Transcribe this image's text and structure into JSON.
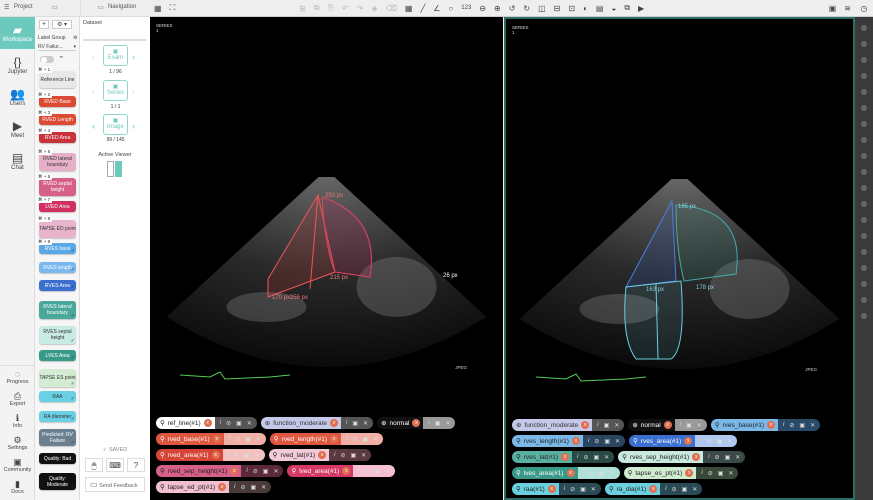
{
  "header": {
    "project": "Project",
    "navigation": "Navigation"
  },
  "sidebar": {
    "main": [
      {
        "label": "Workspace",
        "icon": "image-icon"
      },
      {
        "label": "Jupyter",
        "icon": "braces-icon"
      },
      {
        "label": "Users",
        "icon": "users-icon"
      },
      {
        "label": "Meet",
        "icon": "video-icon"
      },
      {
        "label": "Chat",
        "icon": "chat-icon"
      }
    ],
    "bottom": [
      {
        "label": "Progress",
        "icon": "progress-icon"
      },
      {
        "label": "Export",
        "icon": "export-icon"
      },
      {
        "label": "Info",
        "icon": "info-icon"
      },
      {
        "label": "Settings",
        "icon": "gear-icon"
      },
      {
        "label": "Community",
        "icon": "community-icon"
      },
      {
        "label": "Docs",
        "icon": "docs-icon"
      }
    ]
  },
  "labels": {
    "group_label": "Label Group",
    "group_value": "RV Failur...",
    "items": [
      {
        "label": "Reference Line",
        "key": "⌘ + 1",
        "color": "#e8e8e8",
        "text": "#333"
      },
      {
        "label": "RVED Base",
        "key": "⌘ + 2",
        "color": "#dc4a33",
        "text": "#fff"
      },
      {
        "label": "RVED Length",
        "key": "⌘ + 3",
        "color": "#dc4a33",
        "text": "#fff"
      },
      {
        "label": "RVED Area",
        "key": "⌘ + 4",
        "color": "#c8323a",
        "text": "#fff"
      },
      {
        "label": "RVED lateral boundary",
        "key": "⌘ + 5",
        "color": "#e6b0c8",
        "text": "#333"
      },
      {
        "label": "RVED septal height",
        "key": "⌘ + 6",
        "color": "#d6608a",
        "text": "#fff"
      },
      {
        "label": "LVED Area",
        "key": "⌘ + 7",
        "color": "#d03060",
        "text": "#fff"
      },
      {
        "label": "TAPSE ED point",
        "key": "⌘ + 8",
        "color": "#e8b4cc",
        "text": "#333"
      },
      {
        "label": "RVES base",
        "key": "⌘ + 9",
        "color": "#5aa8e6",
        "text": "#fff"
      },
      {
        "label": "RVES length",
        "key": "",
        "color": "#7ab8ee",
        "text": "#fff"
      },
      {
        "label": "RVES Area",
        "key": "",
        "color": "#3a6fd0",
        "text": "#fff"
      },
      {
        "label": "RVES lateral boundary",
        "key": "",
        "color": "#4aa89a",
        "text": "#fff"
      },
      {
        "label": "RVES septal height",
        "key": "",
        "color": "#c8ece4",
        "text": "#333"
      },
      {
        "label": "LVES Area",
        "key": "",
        "color": "#3a9a8a",
        "text": "#fff"
      },
      {
        "label": "TAPSE ES point",
        "key": "",
        "color": "#d4ecd4",
        "text": "#333"
      },
      {
        "label": "RAA",
        "key": "",
        "color": "#6ad0e4",
        "text": "#333"
      },
      {
        "label": "RA diameter",
        "key": "",
        "color": "#6ad0e4",
        "text": "#333"
      },
      {
        "label": "Predicted: RV Failure",
        "key": "",
        "color": "#6a8090",
        "text": "#fff"
      },
      {
        "label": "Quality: Bad",
        "key": "",
        "color": "#111",
        "text": "#fff"
      },
      {
        "label": "Quality: Moderate",
        "key": "",
        "color": "#111",
        "text": "#fff"
      }
    ]
  },
  "navigation": {
    "dataset": "Dataset",
    "exam": "Exam",
    "exam_count": "1 / 96",
    "series": "Series",
    "series_count": "1 / 1",
    "image": "Image",
    "image_count": "99 / 145",
    "active_viewer": "Active Viewer",
    "saved": "SAVED",
    "send_feedback": "Send Feedback"
  },
  "toolbar": {
    "numbers": "123"
  },
  "viewers": [
    {
      "series_label": "SERIES",
      "series_num": "1",
      "format": "JPEG",
      "measurements": [
        "250 px",
        "215 px",
        "256 px",
        "170 px",
        "26 px"
      ],
      "pills": [
        [
          {
            "name": "ref_line(#1)",
            "icon": "pin",
            "bg": "#ffffff",
            "fg": "#222",
            "rbg": "#555"
          },
          {
            "name": "function_moderate",
            "icon": "globe",
            "bg": "#c5c8e8",
            "fg": "#333",
            "rbg": "#555"
          },
          {
            "name": "normal",
            "icon": "globe",
            "bg": "#111",
            "fg": "#fff",
            "rbg": "#999"
          }
        ],
        [
          {
            "name": "rved_base(#1)",
            "icon": "pin",
            "bg": "#e0573f",
            "fg": "#fff",
            "rbg": "#f0b0a5"
          },
          {
            "name": "rved_length(#1)",
            "icon": "pin",
            "bg": "#e0573f",
            "fg": "#fff",
            "rbg": "#f0b0a5"
          }
        ],
        [
          {
            "name": "rved_area(#1)",
            "icon": "pin",
            "bg": "#d64535",
            "fg": "#fff",
            "rbg": "#f3c0c0"
          },
          {
            "name": "rved_lat(#1)",
            "icon": "pin",
            "bg": "#f2cad8",
            "fg": "#222",
            "rbg": "#5a3a40"
          }
        ],
        [
          {
            "name": "rved_sep_height(#1)",
            "icon": "pin",
            "bg": "#d6608a",
            "fg": "#222",
            "rbg": "#5a2a3a"
          },
          {
            "name": "lved_area(#1)",
            "icon": "pin",
            "bg": "#d63865",
            "fg": "#fff",
            "rbg": "#f5c0d0"
          }
        ],
        [
          {
            "name": "tapse_ed_pt(#1)",
            "icon": "pin",
            "bg": "#f0c0d0",
            "fg": "#222",
            "rbg": "#4a3a3a"
          }
        ]
      ]
    },
    {
      "series_label": "SERIES",
      "series_num": "1",
      "format": "JPEG",
      "measurements": [
        "185 px",
        "163 px",
        "178 px"
      ],
      "pills": [
        [
          {
            "name": "function_moderate",
            "icon": "globe",
            "bg": "#c5c8e8",
            "fg": "#333",
            "rbg": "#555"
          },
          {
            "name": "normal",
            "icon": "globe",
            "bg": "#111",
            "fg": "#fff",
            "rbg": "#999"
          },
          {
            "name": "rves_base(#1)",
            "icon": "pin",
            "bg": "#7ab8e8",
            "fg": "#222",
            "rbg": "#2a4a6a"
          }
        ],
        [
          {
            "name": "rves_length(#1)",
            "icon": "pin",
            "bg": "#7ab8e8",
            "fg": "#222",
            "rbg": "#2a4560"
          },
          {
            "name": "rves_area(#1)",
            "icon": "pin",
            "bg": "#3a70d0",
            "fg": "#fff",
            "rbg": "#b0c8f0"
          }
        ],
        [
          {
            "name": "rves_lat(#1)",
            "icon": "pin",
            "bg": "#5ab0a0",
            "fg": "#222",
            "rbg": "#2a4a45"
          },
          {
            "name": "rves_sep_height(#1)",
            "icon": "pin",
            "bg": "#c8e8e0",
            "fg": "#222",
            "rbg": "#3a4a48"
          }
        ],
        [
          {
            "name": "lves_area(#1)",
            "icon": "pin",
            "bg": "#3a9a8a",
            "fg": "#fff",
            "rbg": "#b0e0d8"
          },
          {
            "name": "tapse_es_pt(#1)",
            "icon": "pin",
            "bg": "#d0ecd0",
            "fg": "#222",
            "rbg": "#3a4a3a"
          }
        ],
        [
          {
            "name": "raa(#1)",
            "icon": "pin",
            "bg": "#6ad0e0",
            "fg": "#222",
            "rbg": "#2a4a55"
          },
          {
            "name": "ra_dia(#1)",
            "icon": "pin",
            "bg": "#6ad0e0",
            "fg": "#222",
            "rbg": "#2a4a55"
          }
        ]
      ]
    }
  ]
}
